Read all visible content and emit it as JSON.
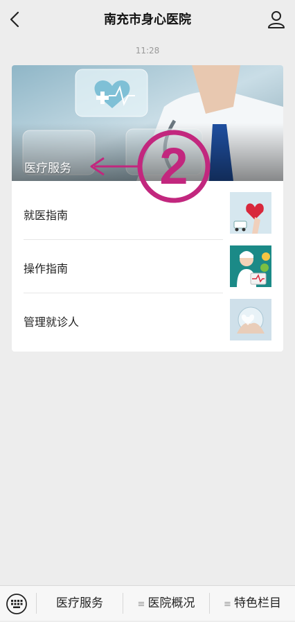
{
  "header": {
    "title": "南充市身心医院"
  },
  "chat": {
    "timestamp": "11:28"
  },
  "article_card": {
    "banner_title": "医疗服务",
    "items": [
      {
        "label": "就医指南",
        "thumb_icon": "doctor-heart-icon"
      },
      {
        "label": "操作指南",
        "thumb_icon": "nurse-icon"
      },
      {
        "label": "管理就诊人",
        "thumb_icon": "hands-icon"
      }
    ]
  },
  "annotation": {
    "number": "2",
    "color": "#c2277e"
  },
  "bottom_menu": {
    "items": [
      {
        "label": "医疗服务"
      },
      {
        "label": "医院概况",
        "icon": "≡"
      },
      {
        "label": "特色栏目",
        "icon": "≡"
      }
    ]
  },
  "colors": {
    "accent": "#c2277e",
    "background": "#ededed"
  }
}
